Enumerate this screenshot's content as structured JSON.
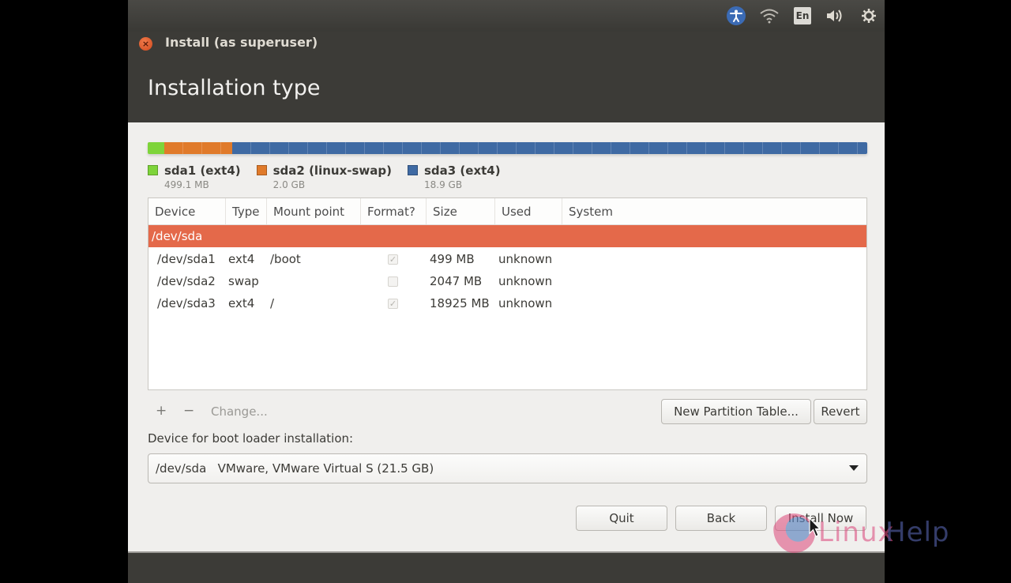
{
  "top_panel": {
    "indicators": [
      {
        "name": "accessibility",
        "icon": "♿"
      },
      {
        "name": "network",
        "icon": "📶"
      },
      {
        "name": "keyboard-layout",
        "label": "En"
      },
      {
        "name": "sound",
        "icon": "🔊"
      },
      {
        "name": "system-settings",
        "icon": "⚙"
      }
    ]
  },
  "window": {
    "title": "Install (as superuser)",
    "close_icon": "×"
  },
  "header": {
    "title": "Installation type"
  },
  "partition_bar": {
    "segments": [
      {
        "name": "sda1",
        "fraction": 0.023,
        "color": "#7ed43a"
      },
      {
        "name": "sda2",
        "fraction": 0.095,
        "color": "#e07a2a"
      },
      {
        "name": "sda3",
        "fraction": 0.882,
        "color": "#3f6aa3"
      }
    ]
  },
  "legend": [
    {
      "label": "sda1 (ext4)",
      "size": "499.1 MB",
      "color": "#7ed43a"
    },
    {
      "label": "sda2 (linux-swap)",
      "size": "2.0 GB",
      "color": "#e07a2a"
    },
    {
      "label": "sda3 (ext4)",
      "size": "18.9 GB",
      "color": "#3f6aa3"
    }
  ],
  "table": {
    "columns": [
      "Device",
      "Type",
      "Mount point",
      "Format?",
      "Size",
      "Used",
      "System"
    ],
    "disk_row": {
      "device": "/dev/sda"
    },
    "rows": [
      {
        "device": "/dev/sda1",
        "type": "ext4",
        "mount": "/boot",
        "format": true,
        "size": "499 MB",
        "used": "unknown",
        "system": ""
      },
      {
        "device": "/dev/sda2",
        "type": "swap",
        "mount": "",
        "format": false,
        "size": "2047 MB",
        "used": "unknown",
        "system": ""
      },
      {
        "device": "/dev/sda3",
        "type": "ext4",
        "mount": "/",
        "format": true,
        "size": "18925 MB",
        "used": "unknown",
        "system": ""
      }
    ]
  },
  "toolbar": {
    "add_label": "+",
    "remove_label": "−",
    "change_label": "Change...",
    "new_table_label": "New Partition Table...",
    "revert_label": "Revert"
  },
  "bootloader": {
    "label": "Device for boot loader installation:",
    "value": "/dev/sda   VMware, VMware Virtual S (21.5 GB)"
  },
  "buttons": {
    "quit": "Quit",
    "back": "Back",
    "install": "Install Now"
  },
  "watermark": {
    "text_a": "Linux",
    "text_b": "Help"
  }
}
